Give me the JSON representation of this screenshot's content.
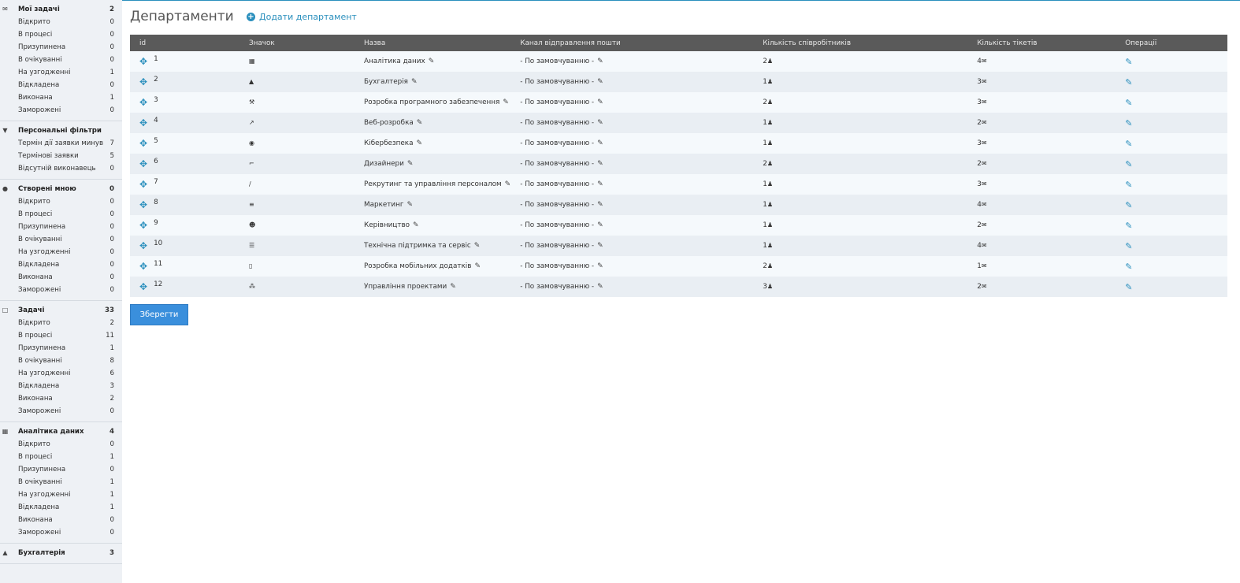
{
  "sidebar": {
    "groups": [
      {
        "icon": "ticket-icon",
        "glyph": "✉",
        "title": "Мої задачі",
        "count": "2",
        "items": [
          [
            "Відкрито",
            "0"
          ],
          [
            "В процесі",
            "0"
          ],
          [
            "Призупинена",
            "0"
          ],
          [
            "В очікуванні",
            "0"
          ],
          [
            "На узгодженні",
            "1"
          ],
          [
            "Відкладена",
            "0"
          ],
          [
            "Виконана",
            "1"
          ],
          [
            "Заморожені",
            "0"
          ]
        ]
      },
      {
        "icon": "filter-icon",
        "glyph": "▼",
        "title": "Персональні фільтри",
        "count": "",
        "items": [
          [
            "Термін дії заявки минув",
            "7"
          ],
          [
            "Термінові заявки",
            "5"
          ],
          [
            "Відсутній виконавець",
            "0"
          ]
        ]
      },
      {
        "icon": "comment-icon",
        "glyph": "●",
        "title": "Створені мною",
        "count": "0",
        "items": [
          [
            "Відкрито",
            "0"
          ],
          [
            "В процесі",
            "0"
          ],
          [
            "Призупинена",
            "0"
          ],
          [
            "В очікуванні",
            "0"
          ],
          [
            "На узгодженні",
            "0"
          ],
          [
            "Відкладена",
            "0"
          ],
          [
            "Виконана",
            "0"
          ],
          [
            "Заморожені",
            "0"
          ]
        ]
      },
      {
        "icon": "clipboard-icon",
        "glyph": "□",
        "title": "Задачі",
        "count": "33",
        "items": [
          [
            "Відкрито",
            "2"
          ],
          [
            "В процесі",
            "11"
          ],
          [
            "Призупинена",
            "1"
          ],
          [
            "В очікуванні",
            "8"
          ],
          [
            "На узгодженні",
            "6"
          ],
          [
            "Відкладена",
            "3"
          ],
          [
            "Виконана",
            "2"
          ],
          [
            "Заморожені",
            "0"
          ]
        ]
      },
      {
        "icon": "database-icon",
        "glyph": "▦",
        "title": "Аналітика даних",
        "count": "4",
        "items": [
          [
            "Відкрито",
            "0"
          ],
          [
            "В процесі",
            "1"
          ],
          [
            "Призупинена",
            "0"
          ],
          [
            "В очікуванні",
            "1"
          ],
          [
            "На узгодженні",
            "1"
          ],
          [
            "Відкладена",
            "1"
          ],
          [
            "Виконана",
            "0"
          ],
          [
            "Заморожені",
            "0"
          ]
        ]
      },
      {
        "icon": "flask-icon",
        "glyph": "▲",
        "title": "Бухгалтерія",
        "count": "3",
        "items": []
      }
    ]
  },
  "header": {
    "title": "Департаменти",
    "add_label": "Додати департамент"
  },
  "table": {
    "columns": [
      "id",
      "Значок",
      "Назва",
      "Канал відправлення пошти",
      "Кількість співробітників",
      "Кількість тікетів",
      "Операції"
    ],
    "rows": [
      {
        "id": "1",
        "icon": "database-icon",
        "glyph": "▦",
        "name": "Аналітика даних",
        "channel": "- По замовчуванню -",
        "employees": "2",
        "tickets": "4"
      },
      {
        "id": "2",
        "icon": "flask-icon",
        "glyph": "▲",
        "name": "Бухгалтерія",
        "channel": "- По замовчуванню -",
        "employees": "1",
        "tickets": "3"
      },
      {
        "id": "3",
        "icon": "wrench-icon",
        "glyph": "⚒",
        "name": "Розробка програмного забезпечення",
        "channel": "- По замовчуванню -",
        "employees": "2",
        "tickets": "3"
      },
      {
        "id": "4",
        "icon": "telescope-icon",
        "glyph": "↗",
        "name": "Веб-розробка",
        "channel": "- По замовчуванню -",
        "employees": "1",
        "tickets": "2"
      },
      {
        "id": "5",
        "icon": "user-secret-icon",
        "glyph": "◉",
        "name": "Кібербезпека",
        "channel": "- По замовчуванню -",
        "employees": "1",
        "tickets": "3"
      },
      {
        "id": "6",
        "icon": "crop-icon",
        "glyph": "⌐",
        "name": "Дизайнери",
        "channel": "- По замовчуванню -",
        "employees": "2",
        "tickets": "2"
      },
      {
        "id": "7",
        "icon": "eyedropper-icon",
        "glyph": "∕",
        "name": "Рекрутинг та управління персоналом",
        "channel": "- По замовчуванню -",
        "employees": "1",
        "tickets": "3"
      },
      {
        "id": "8",
        "icon": "file-icon",
        "glyph": "≡",
        "name": "Маркетинг",
        "channel": "- По замовчуванню -",
        "employees": "1",
        "tickets": "4"
      },
      {
        "id": "9",
        "icon": "user-tie-icon",
        "glyph": "☻",
        "name": "Керівництво",
        "channel": "- По замовчуванню -",
        "employees": "1",
        "tickets": "2"
      },
      {
        "id": "10",
        "icon": "server-icon",
        "glyph": "☰",
        "name": "Технічна підтримка та сервіс",
        "channel": "- По замовчуванню -",
        "employees": "1",
        "tickets": "4"
      },
      {
        "id": "11",
        "icon": "mobile-icon",
        "glyph": "▯",
        "name": "Розробка мобільних додатків",
        "channel": "- По замовчуванню -",
        "employees": "2",
        "tickets": "1"
      },
      {
        "id": "12",
        "icon": "sitemap-icon",
        "glyph": "⁂",
        "name": "Управління проектами",
        "channel": "- По замовчуванню -",
        "employees": "3",
        "tickets": "2"
      }
    ]
  },
  "save_label": "Зберегти",
  "colors": {
    "accent": "#2a8fbd",
    "button": "#3a8fdc",
    "header_bg": "#5a5a5a"
  }
}
